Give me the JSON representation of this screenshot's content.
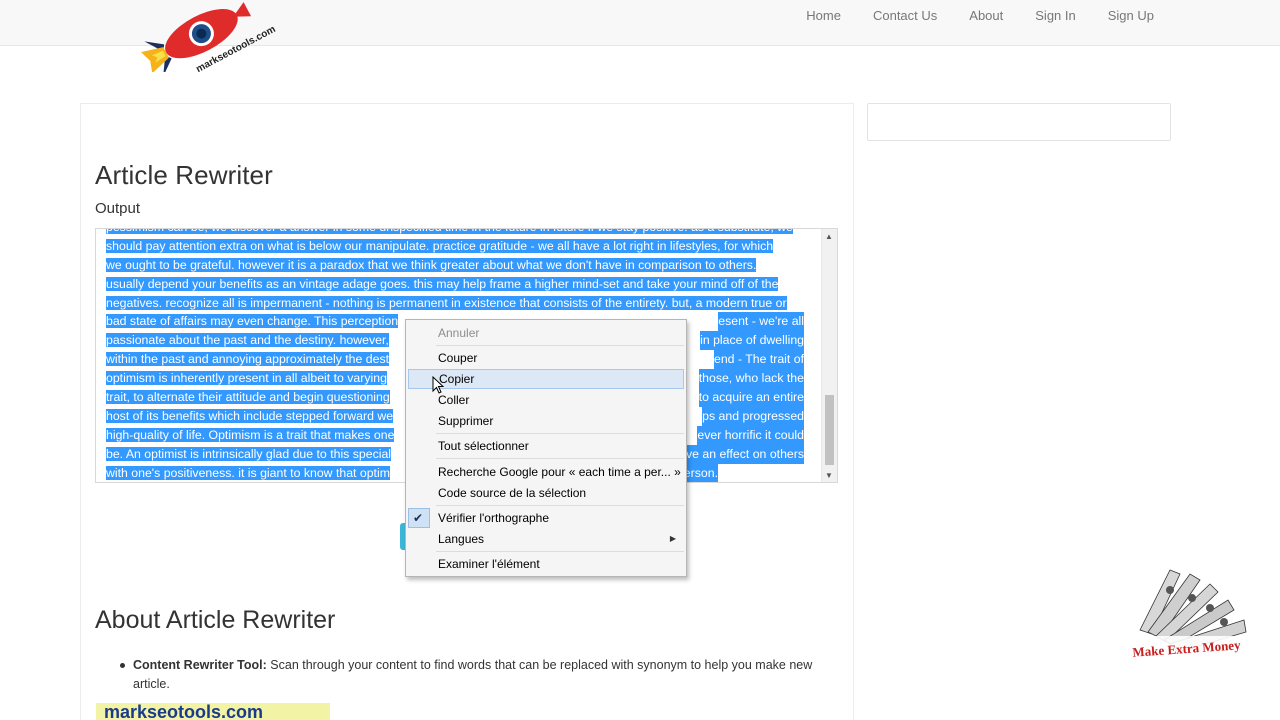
{
  "nav": {
    "logo_text": "markseotools.com",
    "links": [
      "Home",
      "Contact Us",
      "About",
      "Sign In",
      "Sign Up"
    ]
  },
  "main": {
    "title": "Article Rewriter",
    "output_label": "Output",
    "output_lines": [
      "pessimism can be, we discover a answer in some unspecified time in the future in future if we stay positive. as a substitute, we",
      "should pay attention extra on what is below our manipulate. practice gratitude - we all have a lot right in lifestyles, for which",
      "we ought to be grateful. however it is a paradox that we think greater about what we don't have in comparison to others.",
      "usually depend your benefits as an vintage adage goes. this may help frame a higher mind-set and take your mind off of the",
      "negatives. recognize all is impermanent - nothing is permanent in existence that consists of the entirety. but, a modern true or",
      "bad state of affairs may even change. This perception",
      "passionate about the past and the destiny. however,",
      "within the past and annoying approximately the dest",
      "optimism is inherently present in all albeit to varying",
      "trait, to alternate their attitude and begin questioning",
      "host of its benefits which include stepped forward we",
      "high-quality of life. Optimism is a trait that makes one",
      "be. An optimist is intrinsically glad due to this special",
      "with one's positiveness. it is giant to know that optim"
    ],
    "output_lines_right": [
      "",
      "",
      "",
      "",
      "",
      "esent - we're all",
      "in place of dwelling",
      "end - The trait of",
      "those, who lack the",
      "to acquire an entire",
      "ps and progressed",
      "ever horrific it could",
      "ve an effect on others",
      "y person."
    ]
  },
  "context_menu": {
    "items": [
      {
        "label": "Annuler",
        "state": "disabled"
      },
      {
        "label": "Couper",
        "state": "normal"
      },
      {
        "label": "Copier",
        "state": "hover"
      },
      {
        "label": "Coller",
        "state": "normal"
      },
      {
        "label": "Supprimer",
        "state": "normal"
      },
      {
        "label": "Tout sélectionner",
        "state": "normal"
      },
      {
        "label": "Recherche Google pour « each time a per... »",
        "state": "normal"
      },
      {
        "label": "Code source de la sélection",
        "state": "normal"
      },
      {
        "label": "Vérifier l'orthographe",
        "state": "checked"
      },
      {
        "label": "Langues",
        "state": "submenu"
      },
      {
        "label": "Examiner l'élément",
        "state": "normal"
      }
    ]
  },
  "about": {
    "title": "About Article Rewriter",
    "items": [
      {
        "term": "Content Rewriter Tool:",
        "text": "Scan through your content to find words that can be replaced with synonym to help you make new article."
      }
    ],
    "banner_text": "markseotools.com"
  },
  "badge": {
    "label": "Make Extra Money"
  },
  "colors": {
    "selection": "#3399ff",
    "menu_hover": "#dce8f6",
    "badge_red": "#c81e1e"
  }
}
